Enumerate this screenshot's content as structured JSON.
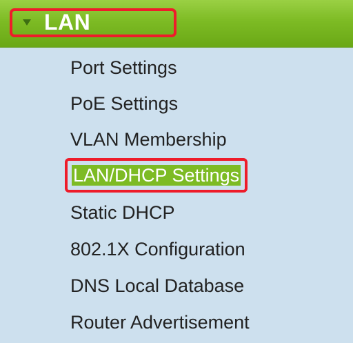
{
  "section": {
    "title": "LAN",
    "expanded": true,
    "accent_color": "#7dbb24",
    "highlight_color": "#ee1c2a"
  },
  "menu": {
    "items": [
      {
        "label": "Port Settings"
      },
      {
        "label": "PoE Settings"
      },
      {
        "label": "VLAN Membership"
      },
      {
        "label": "LAN/DHCP Settings",
        "selected": true
      },
      {
        "label": "Static DHCP"
      },
      {
        "label": "802.1X Configuration"
      },
      {
        "label": "DNS Local Database"
      },
      {
        "label": "Router Advertisement"
      }
    ]
  }
}
